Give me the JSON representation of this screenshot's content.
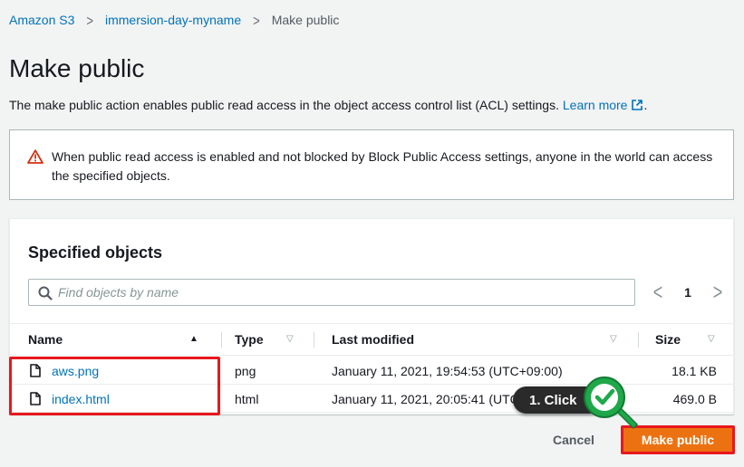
{
  "breadcrumb": {
    "items": [
      "Amazon S3",
      "immersion-day-myname"
    ],
    "current": "Make public",
    "separator": ">"
  },
  "page": {
    "title": "Make public",
    "description": "The make public action enables public read access in the object access control list (ACL) settings.",
    "learn_more": "Learn more",
    "description_end": "."
  },
  "alert": {
    "icon": "warning-icon",
    "text": "When public read access is enabled and not blocked by Block Public Access settings, anyone in the world can access the specified objects."
  },
  "objects_panel": {
    "title": "Specified objects",
    "search_placeholder": "Find objects by name",
    "search_value": "",
    "pagination": {
      "prev": "<",
      "page": "1",
      "next": ">"
    },
    "columns": [
      "Name",
      "Type",
      "Last modified",
      "Size"
    ],
    "rows": [
      {
        "name": "aws.png",
        "type": "png",
        "last_modified": "January 11, 2021, 19:54:53 (UTC+09:00)",
        "size": "18.1 KB"
      },
      {
        "name": "index.html",
        "type": "html",
        "last_modified": "January 11, 2021, 20:05:41 (UTC+09:00)",
        "size": "469.0 B"
      }
    ]
  },
  "actions": {
    "cancel": "Cancel",
    "make_public": "Make public"
  },
  "annotation": {
    "tooltip": "1. Click"
  },
  "colors": {
    "link": "#0073bb",
    "primary_button": "#ec7211",
    "highlight": "#e8171e",
    "warning": "#d13212",
    "click_marker": "#1fa84a"
  }
}
